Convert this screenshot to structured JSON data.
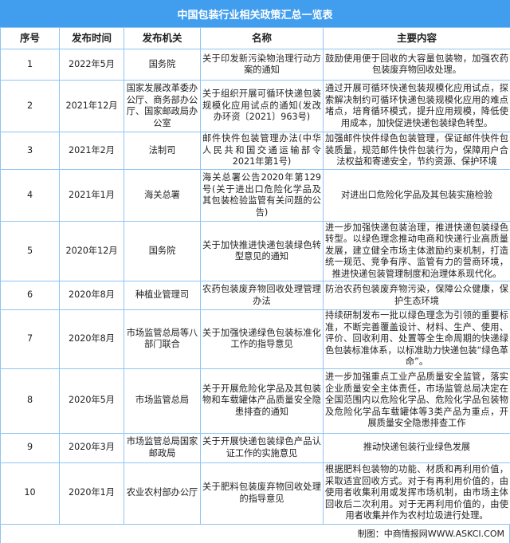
{
  "title": "中国包装行业相关政策汇总一览表",
  "headers": [
    "序号",
    "发布时间",
    "发布机关",
    "名称",
    "主要内容"
  ],
  "rows": [
    {
      "no": "1",
      "date": "2022年5月",
      "org": "国务院",
      "name": "关于印发新污染物治理行动方案的通知",
      "content": "鼓励使用便于回收的大容量包装物，加强农药包装废弃物回收处理。"
    },
    {
      "no": "2",
      "date": "2021年12月",
      "org": "国家发展改革委办公厅、商务部办公厅、国家邮政局办公室",
      "name": "关于组织开展可循环快递包装规模化应用试点的通知(发改办环资〔2021〕963号)",
      "content": "通过开展可循环快递包装规模化应用试点，探索解决制约可循环快递包装规模化应用的难点堵点，培育循环模式，提升应用规模，降低使用成本，加快促进快递包装绿色转型。"
    },
    {
      "no": "3",
      "date": "2021年2月",
      "org": "法制司",
      "name": "邮件快件包装管理办法(中华人民共和国交通运输部令2021年第1号)",
      "content": "加强邮件快件绿色包装管理，保证邮件快件包装质量，规范邮件快件包装行为，保障用户合法权益和寄递安全，节约资源、保护环境"
    },
    {
      "no": "4",
      "date": "2021年1月",
      "org": "海关总署",
      "name": "海关总署公告2020年第129号(关于进出口危险化学品及其包装检验监管有关问题的公告)",
      "content": "对进出口危险化学品及其包装实施检验"
    },
    {
      "no": "5",
      "date": "2020年12月",
      "org": "国务院",
      "name": "关于加快推进快递包装绿色转型意见的通知",
      "content": "进一步加强快递包装治理，推进快递包装绿色转型。以绿色理念推动电商和快递行业高质量发展，建立健全市场主体激励约束机制，打造统一规范、竞争有序、监管有力的营商环境，推进快递包装管理制度和治理体系现代化。"
    },
    {
      "no": "6",
      "date": "2020年8月",
      "org": "种植业管理司",
      "name": "农药包装废弃物回收处理管理办法",
      "content": "防治农药包装废弃物污染，保障公众健康，保护生态环境"
    },
    {
      "no": "7",
      "date": "2020年8月",
      "org": "市场监管总局等八部门联合",
      "name": "关于加强快递绿色包装标准化工作的指导意见",
      "content": "持续研制发布一批以绿色理念为引领的重要标准，不断完善覆盖设计、材料、生产、使用、评价、回收利用、处置等全生命周期的快递绿色包装标准体系，以标准助力快递包装“绿色革命”。"
    },
    {
      "no": "8",
      "date": "2020年5月",
      "org": "市场监管总局",
      "name": "关于开展危险化学品及其包装物和车载罐体产品质量安全隐患排查的通知",
      "content": "进一步加强重点工业产品质量安全监管，落实企业质量安全主体责任，市场监管总局决定在全国范围内以危险化学品、危险化学品包装物及危险化学品车载罐体等3类产品为重点，开展质量安全隐患排查工作"
    },
    {
      "no": "9",
      "date": "2020年3月",
      "org": "市场监管总局国家邮政局",
      "name": "关于开展快递包装绿色产品认证工作的实施意见",
      "content": "推动快递包装行业绿色发展"
    },
    {
      "no": "10",
      "date": "2020年1月",
      "org": "农业农村部办公厅",
      "name": "关于肥料包装废弃物回收处理的指导意见",
      "content": "根据肥料包装物的功能、材质和再利用价值，采取适宜回收方式。对于有再利用价值的，由使用者收集利用或发挥市场机制，由市场主体回收后二次利用。对于无再利用价值的，由使用者收集并作为农村垃圾进行处理。"
    }
  ],
  "footer": "制图：中商情报网WWW.ASKCI.COM"
}
